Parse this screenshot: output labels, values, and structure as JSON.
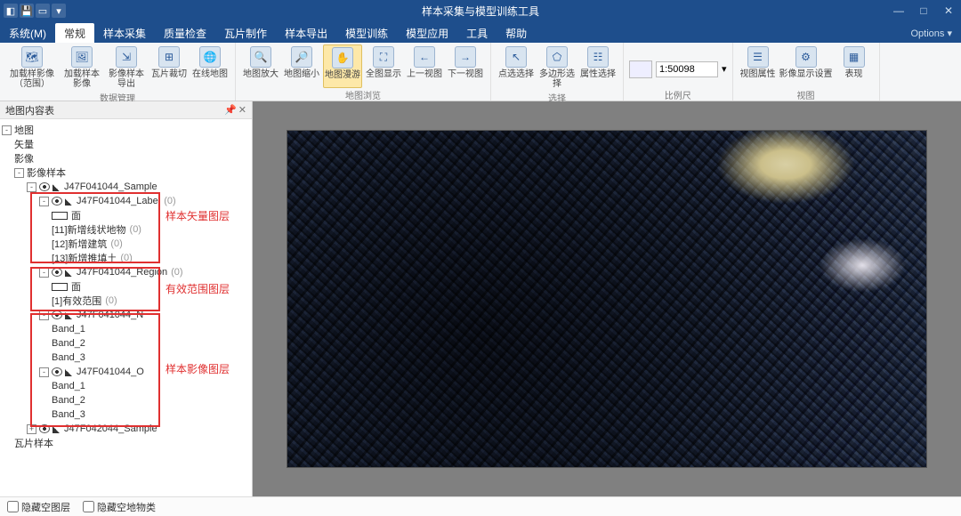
{
  "window": {
    "title": "样本采集与模型训练工具"
  },
  "titlebar_btns": {
    "min": "—",
    "max": "□",
    "close": "✕"
  },
  "sysmenu": "系统(M)",
  "tabs": [
    "常规",
    "样本采集",
    "质量检查",
    "瓦片制作",
    "样本导出",
    "模型训练",
    "模型应用",
    "工具",
    "帮助"
  ],
  "options": "Options ▾",
  "ribbon": {
    "g1": {
      "label": "数据管理",
      "btns": [
        "加载样影像（范围）",
        "加载样本影像",
        "影像样本导出",
        "瓦片裁切",
        "在线地图"
      ]
    },
    "g2": {
      "label": "地图浏览",
      "btns": [
        "地图放大",
        "地图缩小",
        "地图漫游",
        "全图显示",
        "上一视图",
        "下一视图"
      ]
    },
    "g3": {
      "label": "选择",
      "btns": [
        "点选选择",
        "多边形选择",
        "属性选择"
      ]
    },
    "g4": {
      "label": "比例尺",
      "scale": "1:50098"
    },
    "g5": {
      "label": "视图",
      "btns": [
        "视图属性",
        "影像显示设置",
        "表现"
      ]
    }
  },
  "leftpanel": {
    "title": "地图内容表",
    "root": "地图",
    "n_vector": "矢量",
    "n_raster": "影像",
    "n_samples": "影像样本",
    "sample_root": "J47F041044_Sample",
    "label_layer": "J47F041044_Label",
    "face": "面",
    "lbl_items": [
      "[11]新增线状地物",
      "[12]新增建筑",
      "[13]新增推填土"
    ],
    "region_layer": "J47F041044_Region",
    "region_item": "[1]有效范围",
    "n_layer": "J47F041044_N",
    "o_layer": "J47F041044_O",
    "bands": [
      "Band_1",
      "Band_2",
      "Band_3"
    ],
    "sample2": "J47F042044_Sample",
    "tiles": "瓦片样本",
    "zero": "(0)"
  },
  "annotations": {
    "a1": "样本矢量图层",
    "a2": "有效范围图层",
    "a3": "样本影像图层"
  },
  "btmbar": {
    "c1": "隐藏空图层",
    "c2": "隐藏空地物类"
  }
}
